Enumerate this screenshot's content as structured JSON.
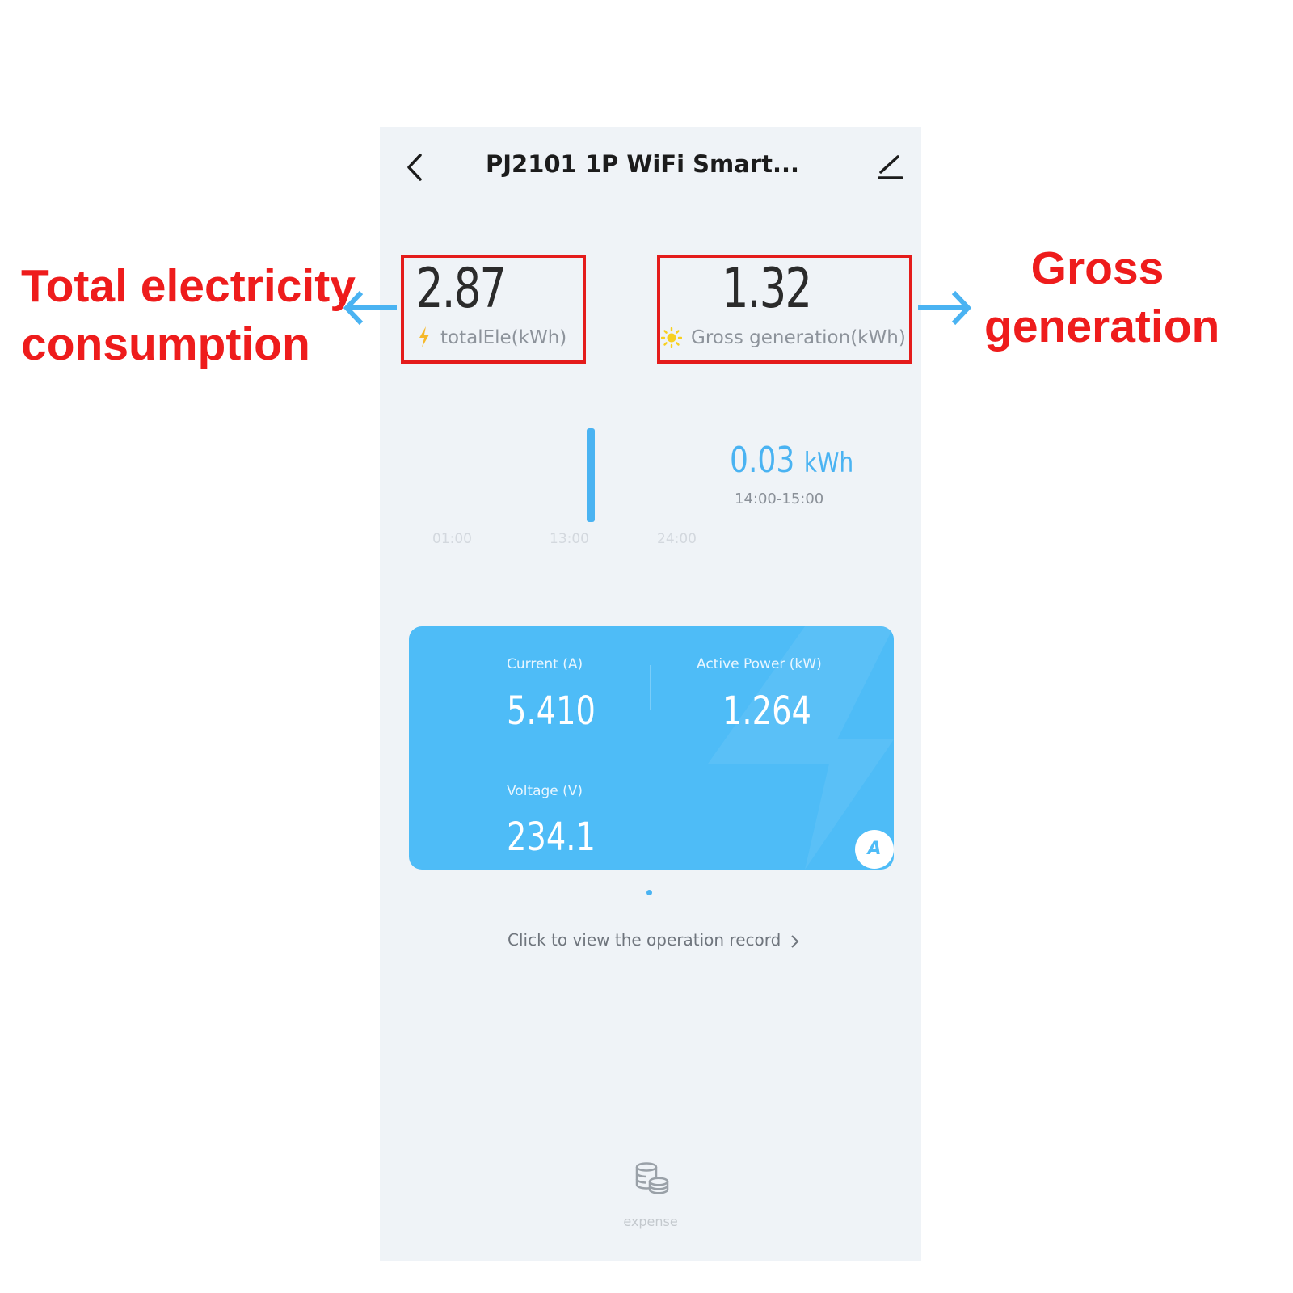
{
  "annotations": {
    "left_label_line1": "Total electricity",
    "left_label_line2": "consumption",
    "right_label_line1": "Gross",
    "right_label_line2": "generation",
    "box_color": "#e41b1b",
    "label_color": "#ee1c1c",
    "arrow_color": "#4ab3f2"
  },
  "header": {
    "title": "PJ2101 1P WiFi Smart...",
    "back_icon": "chevron-left-icon",
    "edit_icon": "pencil-icon"
  },
  "stats": {
    "total": {
      "value": "2.87",
      "label": "totalEle(kWh)",
      "icon": "lightning-icon"
    },
    "gross": {
      "value": "1.32",
      "label": "Gross generation(kWh)",
      "icon": "sun-icon"
    }
  },
  "chart": {
    "ticks": [
      "01:00",
      "13:00",
      "24:00"
    ],
    "readout_value": "0.03",
    "readout_unit": "kWh",
    "readout_time": "14:00-15:00"
  },
  "chart_data": {
    "type": "bar",
    "categories": [
      "14:00-15:00"
    ],
    "values": [
      0.03
    ],
    "x_ticks": [
      "01:00",
      "13:00",
      "24:00"
    ]
  },
  "card": {
    "current_label": "Current (A)",
    "current_value": "5.410",
    "power_label": "Active Power (kW)",
    "power_value": "1.264",
    "voltage_label": "Voltage (V)",
    "voltage_value": "234.1",
    "mode_badge": "A",
    "color": "#4ebcf7"
  },
  "footer": {
    "record_link": "Click to view the operation record",
    "expense_label": "expense",
    "expense_icon": "coins-icon"
  }
}
